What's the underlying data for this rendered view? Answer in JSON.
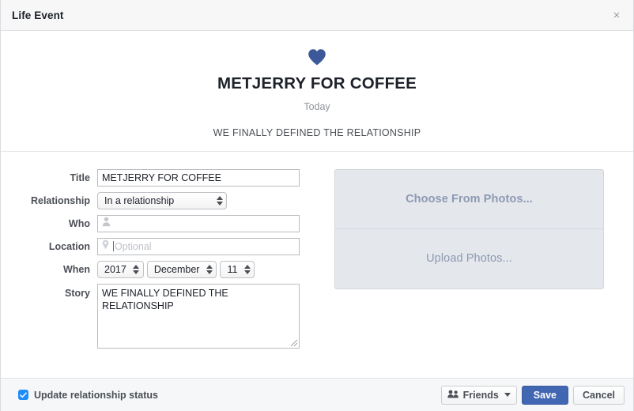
{
  "window": {
    "title": "Life Event",
    "close_label": "×"
  },
  "hero": {
    "icon": "heart-icon",
    "title": "METJERRY FOR COFFEE",
    "date": "Today",
    "story": "WE FINALLY DEFINED THE RELATIONSHIP"
  },
  "form": {
    "title_label": "Title",
    "title_value": "METJERRY FOR COFFEE",
    "relationship_label": "Relationship",
    "relationship_value": "In a relationship",
    "who_label": "Who",
    "who_value": "",
    "who_icon": "person-icon",
    "location_label": "Location",
    "location_value": "",
    "location_placeholder": "Optional",
    "location_icon": "map-pin-icon",
    "when_label": "When",
    "when_year": "2017",
    "when_month": "December",
    "when_day": "11",
    "story_label": "Story",
    "story_value": "WE FINALLY DEFINED THE RELATIONSHIP"
  },
  "photos": {
    "choose_label": "Choose From Photos...",
    "upload_label": "Upload Photos..."
  },
  "footer": {
    "checkbox_label": "Update relationship status",
    "checkbox_checked": true,
    "audience_label": "Friends",
    "audience_icon": "friends-icon",
    "save_label": "Save",
    "cancel_label": "Cancel"
  },
  "colors": {
    "accent_blue": "#4267b2",
    "checkbox_blue": "#1c8cf8",
    "heart_blue": "#3b5998",
    "photo_text": "#8d9ab3"
  }
}
